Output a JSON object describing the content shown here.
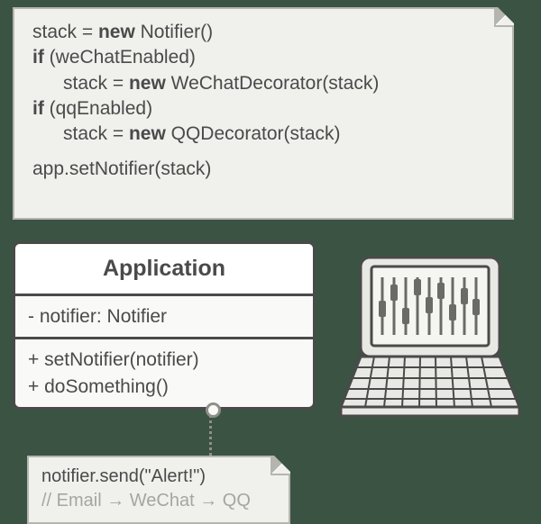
{
  "code": {
    "l1a": "stack = ",
    "l1kw": "new",
    "l1b": " Notifier()",
    "l2kw": "if",
    "l2a": " (weChatEnabled)",
    "l3a": "stack = ",
    "l3kw": "new",
    "l3b": " WeChatDecorator(stack)",
    "l4kw": "if",
    "l4a": " (qqEnabled)",
    "l5a": "stack = ",
    "l5kw": "new",
    "l5b": " QQDecorator(stack)",
    "l6": "app.setNotifier(stack)"
  },
  "uml": {
    "name": "Application",
    "field": "- notifier: Notifier",
    "m1": "+ setNotifier(notifier)",
    "m2": "+ doSomething()"
  },
  "call": {
    "line": "notifier.send(\"Alert!\")",
    "comment": "// Email → WeChat → QQ"
  }
}
